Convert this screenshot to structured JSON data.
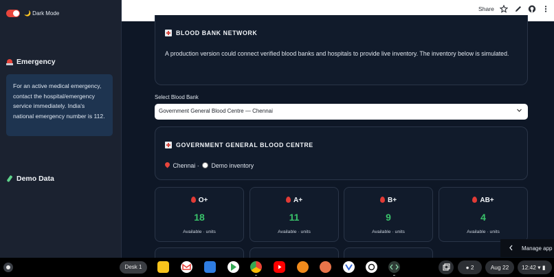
{
  "sidebar": {
    "dark_mode_label": "🌙 Dark Mode",
    "emergency_heading": "Emergency",
    "emergency_text": "For an active medical emergency, contact the hospital/emergency service immediately. India's national emergency number is 112.",
    "demo_heading": "Demo Data"
  },
  "header": {
    "share_label": "Share",
    "icons": [
      "star-icon",
      "edit-icon",
      "github-icon",
      "more-icon"
    ]
  },
  "network": {
    "title": "BLOOD BANK NETWORK",
    "text": "A production version could connect verified blood banks and hospitals to provide live inventory. The inventory below is simulated."
  },
  "selector": {
    "label": "Select Blood Bank",
    "value": "Government General Blood Centre — Chennai"
  },
  "centre": {
    "title": "GOVERNMENT GENERAL BLOOD CENTRE",
    "location": "Chennai",
    "mode": "Demo inventory"
  },
  "inventory": [
    {
      "type": "O+",
      "units": "18",
      "caption": "Available · units"
    },
    {
      "type": "A+",
      "units": "11",
      "caption": "Available · units"
    },
    {
      "type": "B+",
      "units": "9",
      "caption": "Available · units"
    },
    {
      "type": "AB+",
      "units": "4",
      "caption": "Available · units"
    }
  ],
  "manage_app": "Manage app",
  "taskbar": {
    "desk_label": "Desk 1",
    "notifications": "2",
    "date": "Aug 22",
    "time": "12:42"
  },
  "colors": {
    "accent_red": "#e8453c",
    "units_green": "#39c26a",
    "background": "#0e1726"
  }
}
